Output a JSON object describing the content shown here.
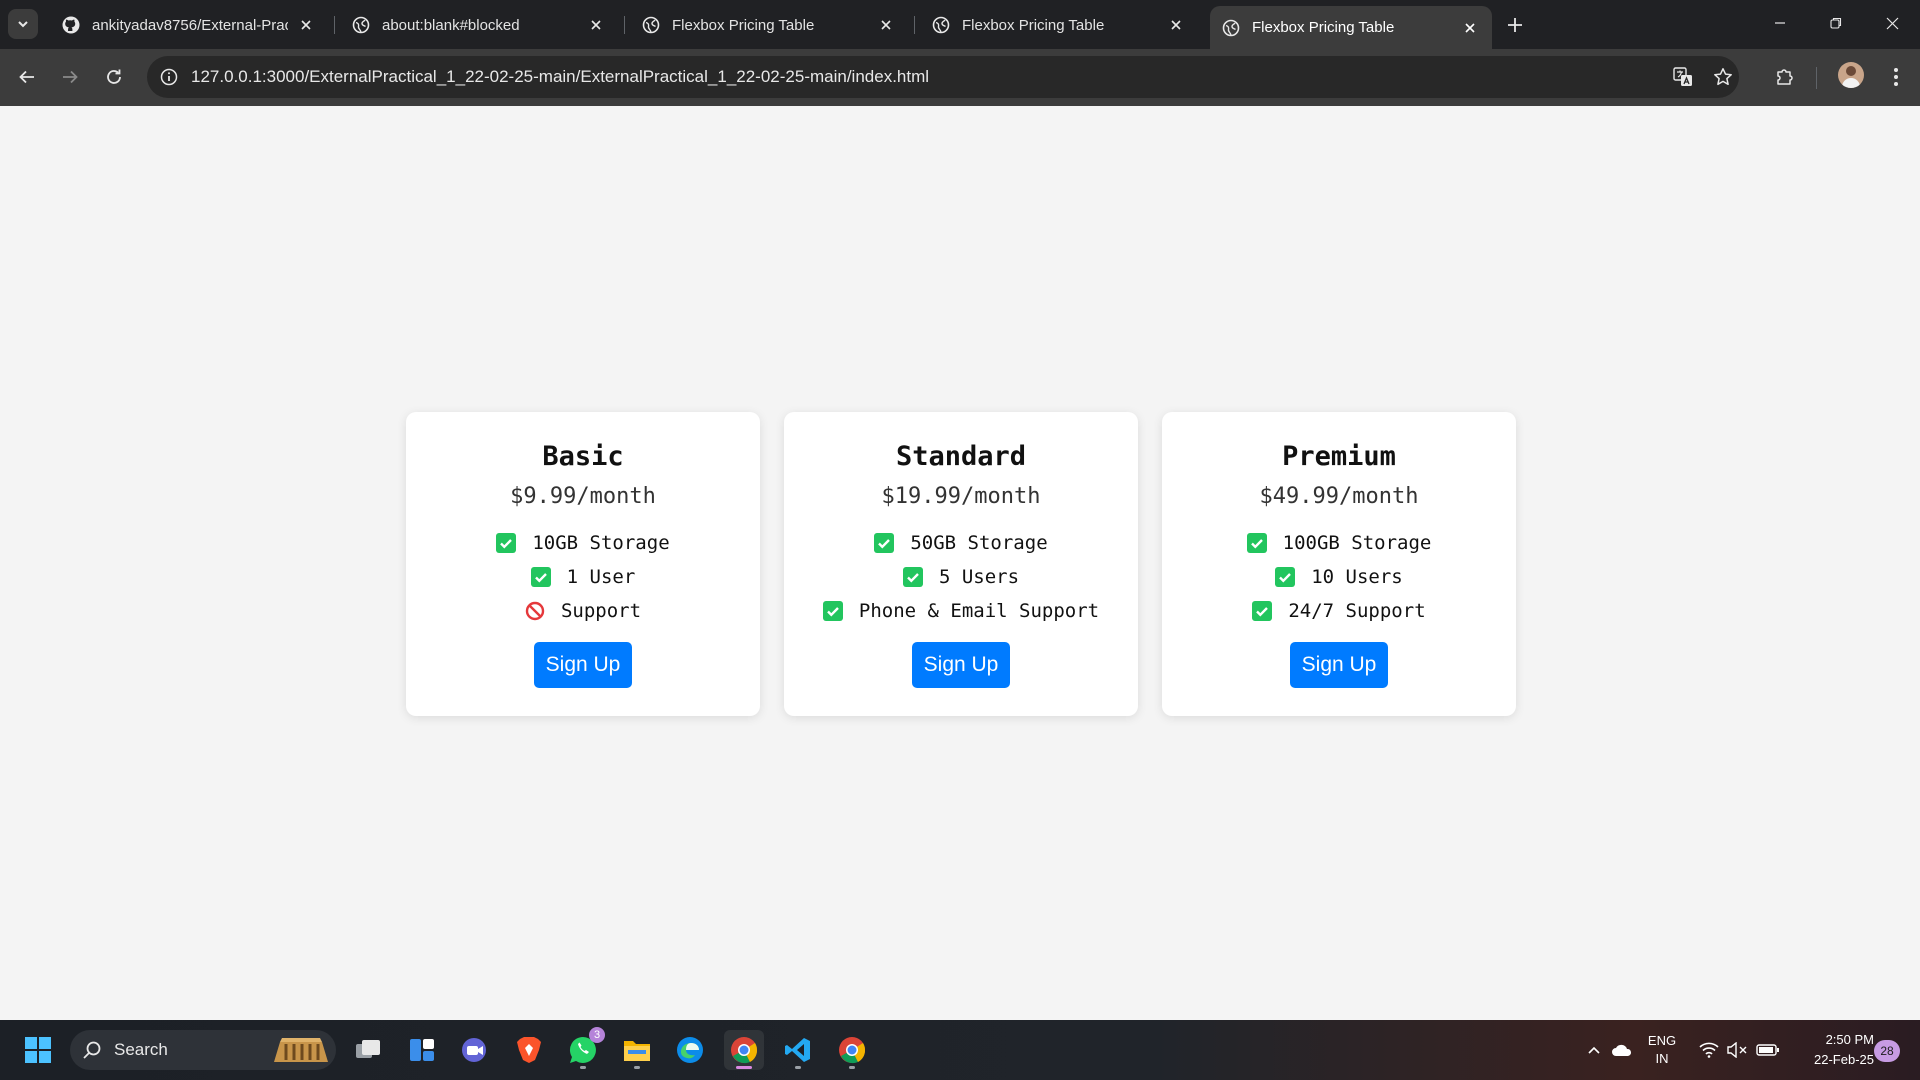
{
  "browser": {
    "tabs": [
      {
        "title": "ankityadav8756/External-Practi",
        "favicon": "github-icon",
        "active": false
      },
      {
        "title": "about:blank#blocked",
        "favicon": "globe-icon",
        "active": false
      },
      {
        "title": "Flexbox Pricing Table",
        "favicon": "globe-icon",
        "active": false
      },
      {
        "title": "Flexbox Pricing Table",
        "favicon": "globe-icon",
        "active": false
      },
      {
        "title": "Flexbox Pricing Table",
        "favicon": "globe-icon",
        "active": true
      }
    ],
    "url": "127.0.0.1:3000/ExternalPractical_1_22-02-25-main/ExternalPractical_1_22-02-25-main/index.html"
  },
  "plans": [
    {
      "name": "Basic",
      "price": "$9.99/month",
      "features": [
        {
          "text": "10GB Storage",
          "included": true
        },
        {
          "text": "1 User",
          "included": true
        },
        {
          "text": "Support",
          "included": false
        }
      ],
      "button": "Sign Up"
    },
    {
      "name": "Standard",
      "price": "$19.99/month",
      "features": [
        {
          "text": "50GB Storage",
          "included": true
        },
        {
          "text": "5 Users",
          "included": true
        },
        {
          "text": "Phone & Email Support",
          "included": true
        }
      ],
      "button": "Sign Up"
    },
    {
      "name": "Premium",
      "price": "$49.99/month",
      "features": [
        {
          "text": "100GB Storage",
          "included": true
        },
        {
          "text": "10 Users",
          "included": true
        },
        {
          "text": "24/7 Support",
          "included": true
        }
      ],
      "button": "Sign Up"
    }
  ],
  "taskbar": {
    "search_label": "Search",
    "whatsapp_badge": "3",
    "lang_line1": "ENG",
    "lang_line2": "IN",
    "time": "2:50 PM",
    "date": "22-Feb-25",
    "notification_count": "28"
  },
  "colors": {
    "accent": "#007bff",
    "check": "#22c55e",
    "cross": "#e5383b",
    "page_bg": "#f4f4f4"
  }
}
